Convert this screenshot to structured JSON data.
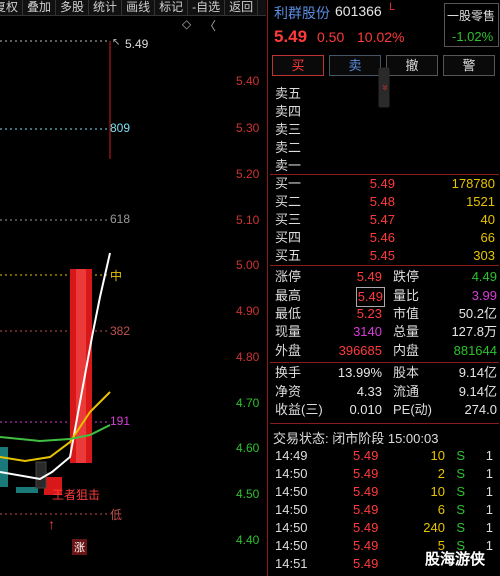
{
  "toolbar": [
    "复权",
    "叠加",
    "多股",
    "统计",
    "画线",
    "标记",
    "-自选",
    "返回"
  ],
  "chart": {
    "price_ticks": [
      "5.40",
      "5.30",
      "5.20",
      "5.10",
      "5.00",
      "4.90",
      "4.80",
      "4.70",
      "4.60",
      "4.50",
      "4.40"
    ],
    "high_label": "5.49",
    "levels": {
      "l809": "809",
      "l618": "618",
      "l382": "382",
      "l191": "191",
      "mid": "中",
      "low": "低"
    },
    "signal_text": "王者狙击",
    "zhang": "涨",
    "diamond": "◇",
    "scroll_arrow": "〈"
  },
  "stock": {
    "name": "利群股份",
    "code": "601366",
    "flag": "L",
    "price": "5.49",
    "change": "0.50",
    "change_pct": "10.02%",
    "odd_lot_label": "一股零售",
    "odd_lot_value": "-1.02%"
  },
  "buttons": {
    "buy": "买",
    "sell": "卖",
    "cancel": "撤",
    "alert": "警"
  },
  "collapse_icon": "»",
  "asks": [
    {
      "label": "卖五",
      "price": "",
      "volume": ""
    },
    {
      "label": "卖四",
      "price": "",
      "volume": ""
    },
    {
      "label": "卖三",
      "price": "",
      "volume": ""
    },
    {
      "label": "卖二",
      "price": "",
      "volume": ""
    },
    {
      "label": "卖一",
      "price": "",
      "volume": ""
    }
  ],
  "bids": [
    {
      "label": "买一",
      "price": "5.49",
      "volume": "178780"
    },
    {
      "label": "买二",
      "price": "5.48",
      "volume": "1521"
    },
    {
      "label": "买三",
      "price": "5.47",
      "volume": "40"
    },
    {
      "label": "买四",
      "price": "5.46",
      "volume": "66"
    },
    {
      "label": "买五",
      "price": "5.45",
      "volume": "303"
    }
  ],
  "stats": {
    "limit_up_lbl": "涨停",
    "limit_up": "5.49",
    "limit_down_lbl": "跌停",
    "limit_down": "4.49",
    "high_lbl": "最高",
    "high": "5.49",
    "vol_ratio_lbl": "量比",
    "vol_ratio": "3.99",
    "low_lbl": "最低",
    "low": "5.23",
    "mktcap_lbl": "市值",
    "mktcap": "50.2亿",
    "cur_vol_lbl": "现量",
    "cur_vol": "3140",
    "total_vol_lbl": "总量",
    "total_vol": "127.8万",
    "outer_lbl": "外盘",
    "outer": "396685",
    "inner_lbl": "内盘",
    "inner": "881644",
    "turnover_lbl": "换手",
    "turnover": "13.99%",
    "equity_lbl": "股本",
    "equity": "9.14亿",
    "nav_lbl": "净资",
    "nav": "4.33",
    "float_lbl": "流通",
    "float": "9.14亿",
    "eps_lbl": "收益(三)",
    "eps": "0.010",
    "pe_lbl": "PE(动)",
    "pe": "274.0"
  },
  "status": "交易状态: 闭市阶段 15:00:03",
  "ticks": [
    {
      "time": "14:49",
      "price": "5.49",
      "vol": "10",
      "dir": "S",
      "num": "1"
    },
    {
      "time": "14:50",
      "price": "5.49",
      "vol": "2",
      "dir": "S",
      "num": "1"
    },
    {
      "time": "14:50",
      "price": "5.49",
      "vol": "10",
      "dir": "S",
      "num": "1"
    },
    {
      "time": "14:50",
      "price": "5.49",
      "vol": "6",
      "dir": "S",
      "num": "1"
    },
    {
      "time": "14:50",
      "price": "5.49",
      "vol": "240",
      "dir": "S",
      "num": "1"
    },
    {
      "time": "14:50",
      "price": "5.49",
      "vol": "5",
      "dir": "S",
      "num": "1"
    },
    {
      "time": "14:51",
      "price": "5.49",
      "vol": "",
      "dir": "",
      "num": ""
    }
  ],
  "watermark": "股海游侠",
  "colors": {
    "up": "#ff3b3b",
    "down": "#2ec12e",
    "volume": "#e6c400",
    "name": "#5a8de0",
    "border": "#8a1b1b"
  }
}
